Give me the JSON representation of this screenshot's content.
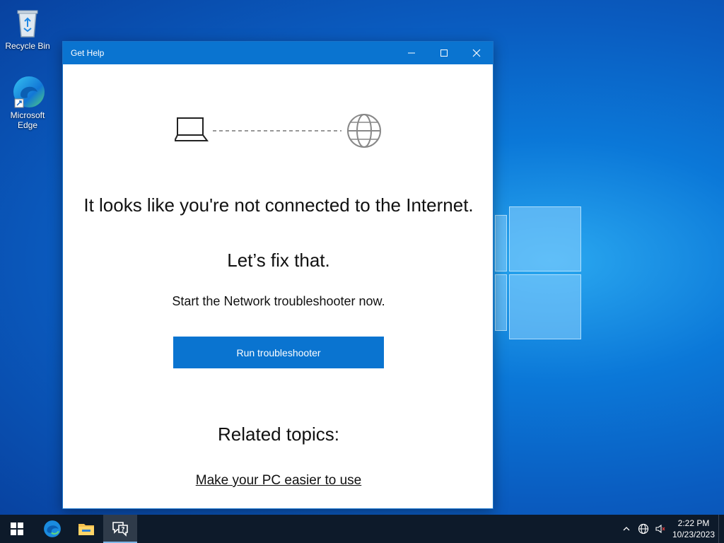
{
  "desktop": {
    "icons": [
      {
        "label": "Recycle Bin",
        "icon": "recycle-bin-icon"
      },
      {
        "label": "Microsoft Edge",
        "icon": "edge-icon"
      }
    ]
  },
  "window": {
    "title": "Get Help",
    "controls": {
      "minimize": "minimize-icon",
      "maximize": "maximize-icon",
      "close": "close-icon"
    },
    "illustration": {
      "left_icon": "laptop-icon",
      "right_icon": "globe-icon"
    },
    "heading": "It looks like you're not connected to the Internet.",
    "fix_text": "Let’s fix that.",
    "subtext": "Start the Network troubleshooter now.",
    "button_label": "Run troubleshooter",
    "related_title": "Related topics:",
    "related_link": "Make your PC easier to use"
  },
  "taskbar": {
    "apps": [
      {
        "name": "Start",
        "icon": "windows-start-icon"
      },
      {
        "name": "Microsoft Edge",
        "icon": "edge-icon"
      },
      {
        "name": "File Explorer",
        "icon": "folder-icon"
      },
      {
        "name": "Get Help",
        "icon": "get-help-icon",
        "active": true
      }
    ],
    "tray": {
      "icons": [
        "chevron-up-icon",
        "network-globe-icon",
        "speaker-icon"
      ],
      "time": "2:22 PM",
      "date": "10/23/2023"
    }
  },
  "colors": {
    "accent": "#0a74d0",
    "taskbar": "#0d1a2a"
  }
}
